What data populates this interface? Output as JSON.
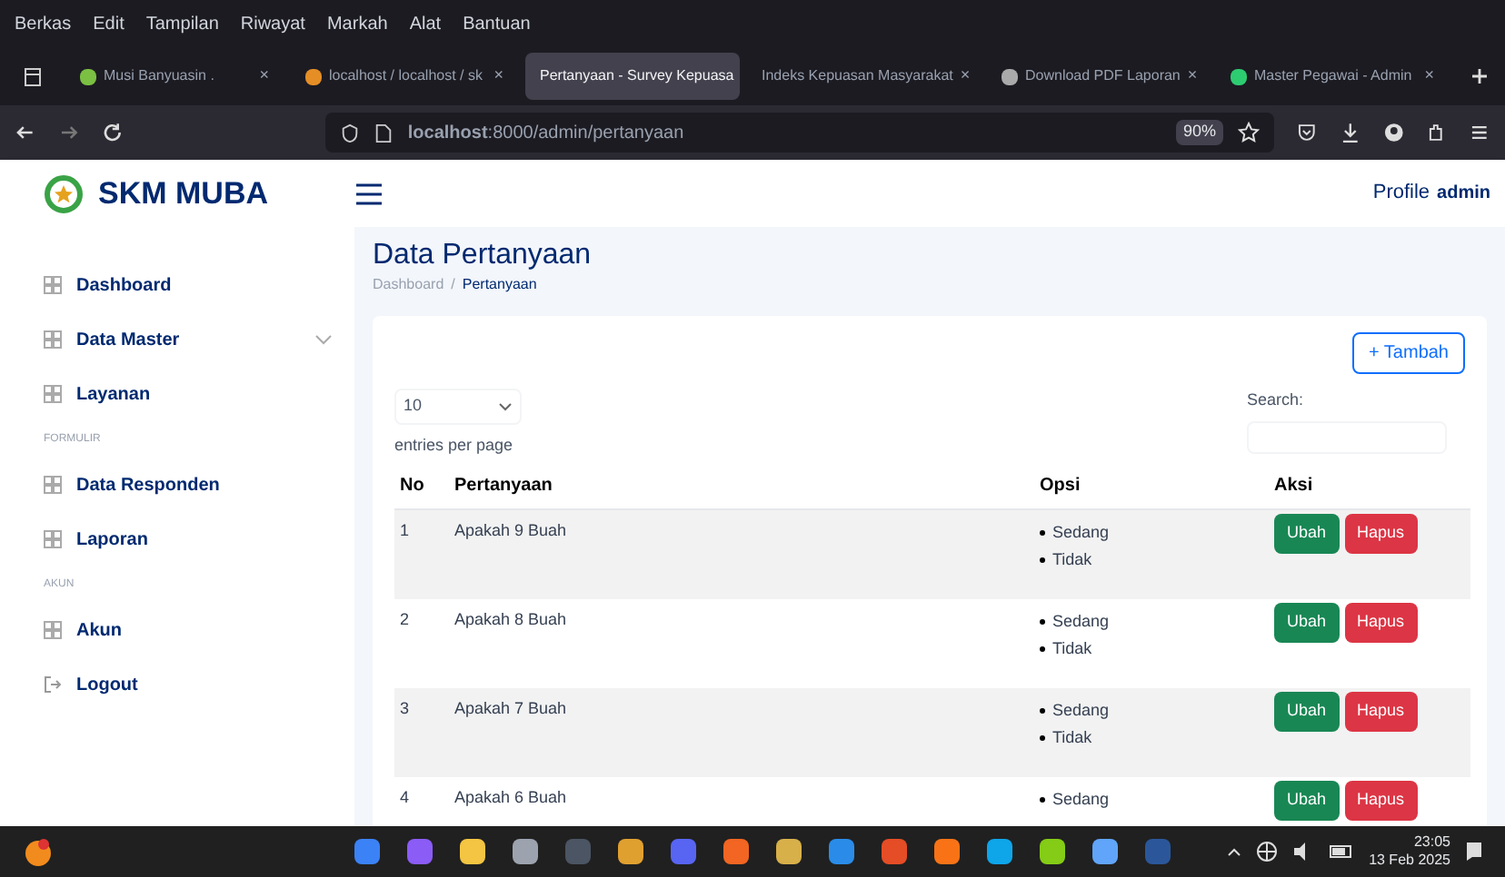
{
  "browser": {
    "menu": [
      "Berkas",
      "Edit",
      "Tampilan",
      "Riwayat",
      "Markah",
      "Alat",
      "Bantuan"
    ],
    "tabs": [
      {
        "title": "Musi Banyuasin .",
        "selected": false
      },
      {
        "title": "localhost / localhost / sk",
        "selected": false
      },
      {
        "title": "Pertanyaan - Survey Kepuasa",
        "selected": true
      },
      {
        "title": "Indeks Kepuasan Masyarakat",
        "selected": false
      },
      {
        "title": "Download PDF Laporan",
        "selected": false
      },
      {
        "title": "Master Pegawai - Admin",
        "selected": false
      }
    ],
    "tab_close": "×",
    "url": "**localhost**:8000/admin/pertanyaan",
    "zoom": "90%"
  },
  "header": {
    "brand": "SKM MUBA",
    "profile": "Profile",
    "user": "admin"
  },
  "sidebar": {
    "items": [
      {
        "kind": "item",
        "label": "Dashboard"
      },
      {
        "kind": "group",
        "label": "Data Master",
        "expanded": false
      },
      {
        "kind": "item",
        "label": "Layanan"
      },
      {
        "kind": "heading",
        "label": "FORMULIR"
      },
      {
        "kind": "item",
        "label": "Data Responden"
      },
      {
        "kind": "item",
        "label": "Laporan"
      },
      {
        "kind": "heading",
        "label": "AKUN"
      },
      {
        "kind": "item",
        "label": "Akun"
      },
      {
        "kind": "logout",
        "label": "Logout"
      }
    ]
  },
  "page": {
    "title": "Data Pertanyaan",
    "breadcrumb": [
      "Dashboard",
      "Pertanyaan"
    ],
    "breadcrumb_separator": "/",
    "add_button": "+ Tambah",
    "entries_value": "10",
    "entries_label": "entries per page",
    "search_label": "Search:",
    "columns": [
      "No",
      "Pertanyaan",
      "Opsi",
      "Aksi"
    ],
    "rows": [
      {
        "no": "1",
        "question": "Apakah 9 Buah",
        "options": [
          "Sedang",
          "Tidak"
        ],
        "actions": [
          "Ubah",
          "Hapus"
        ]
      },
      {
        "no": "2",
        "question": "Apakah 8 Buah",
        "options": [
          "Sedang",
          "Tidak"
        ],
        "actions": [
          "Ubah",
          "Hapus"
        ]
      },
      {
        "no": "3",
        "question": "Apakah 7 Buah",
        "options": [
          "Sedang",
          "Tidak"
        ],
        "actions": [
          "Ubah",
          "Hapus"
        ]
      },
      {
        "no": "4",
        "question": "Apakah 6 Buah",
        "options": [
          "Sedang"
        ],
        "actions": [
          "Ubah",
          "Hapus"
        ]
      }
    ]
  },
  "taskbar": {
    "time": "23:05",
    "date": "13 Feb 2025"
  }
}
